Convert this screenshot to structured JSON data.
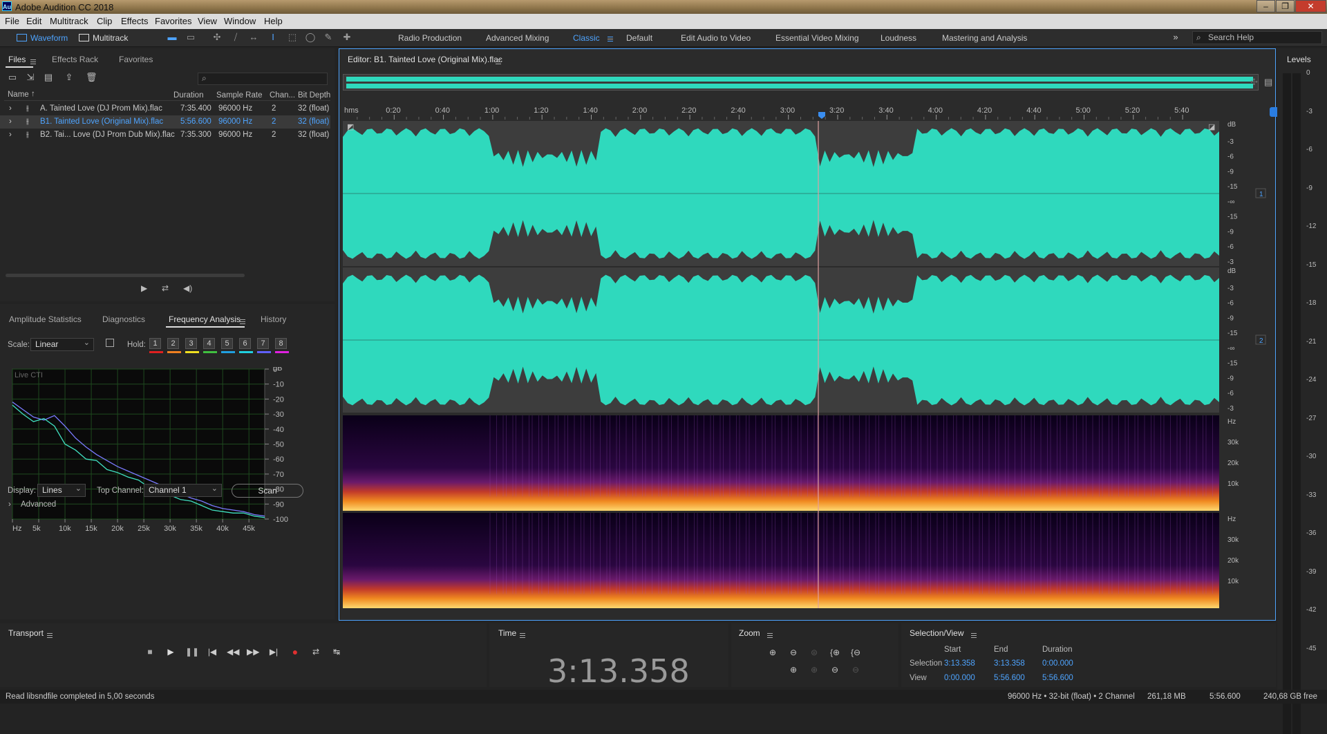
{
  "window": {
    "title": "Adobe Audition CC 2018",
    "app_icon": "Au"
  },
  "menu": [
    "File",
    "Edit",
    "Multitrack",
    "Clip",
    "Effects",
    "Favorites",
    "View",
    "Window",
    "Help"
  ],
  "modes": {
    "waveform": "Waveform",
    "multitrack": "Multitrack"
  },
  "workspaces": [
    "Radio Production",
    "Advanced Mixing",
    "Classic",
    "Default",
    "Edit Audio to Video",
    "Essential Video Mixing",
    "Loudness",
    "Mastering and Analysis"
  ],
  "active_workspace": "Classic",
  "search_help": {
    "placeholder": "Search Help"
  },
  "files_panel": {
    "tabs": [
      "Files",
      "Effects Rack",
      "Favorites"
    ],
    "columns": [
      "Name",
      "Duration",
      "Sample Rate",
      "Chan...",
      "Bit Depth"
    ],
    "rows": [
      {
        "name": "A. Tainted Love (DJ Prom Mix).flac",
        "duration": "7:35.400",
        "rate": "96000 Hz",
        "chan": "2",
        "depth": "32 (float)",
        "selected": false
      },
      {
        "name": "B1. Tainted Love (Original Mix).flac",
        "duration": "5:56.600",
        "rate": "96000 Hz",
        "chan": "2",
        "depth": "32 (float)",
        "selected": true
      },
      {
        "name": "B2. Tai... Love (DJ Prom Dub Mix).flac",
        "duration": "7:35.300",
        "rate": "96000 Hz",
        "chan": "2",
        "depth": "32 (float)",
        "selected": false
      }
    ]
  },
  "analysis_panel": {
    "tabs": [
      "Amplitude Statistics",
      "Diagnostics",
      "Frequency Analysis",
      "History"
    ],
    "active_tab": "Frequency Analysis",
    "scale_label": "Scale:",
    "scale_value": "Linear",
    "hold_label": "Hold:",
    "hold_buttons": [
      "1",
      "2",
      "3",
      "4",
      "5",
      "6",
      "7",
      "8"
    ],
    "hold_colors": [
      "#e02020",
      "#f08020",
      "#f0e020",
      "#40c040",
      "#20a0e0",
      "#20d0e0",
      "#6060ff",
      "#e020e0"
    ],
    "live_label": "Live CTI",
    "display_label": "Display:",
    "display_value": "Lines",
    "topchannel_label": "Top Channel:",
    "topchannel_value": "Channel 1",
    "scan_label": "Scan",
    "advanced_label": "Advanced"
  },
  "chart_data": {
    "type": "line",
    "x_ticks": [
      "Hz",
      "5k",
      "10k",
      "15k",
      "20k",
      "25k",
      "30k",
      "35k",
      "40k",
      "45k"
    ],
    "y_ticks": [
      "dB",
      "0",
      "-10",
      "-20",
      "-30",
      "-40",
      "-50",
      "-60",
      "-70",
      "-80",
      "-90",
      "-100"
    ],
    "xlim": [
      0,
      48000
    ],
    "ylim": [
      -100,
      0
    ],
    "series": [
      {
        "color": "#7a7aff",
        "x": [
          0,
          2000,
          4000,
          6000,
          8000,
          10000,
          12000,
          14000,
          16000,
          18000,
          20000,
          22000,
          24000,
          26000,
          28000,
          30000,
          32000,
          34000,
          36000,
          38000,
          40000,
          42000,
          44000,
          46000,
          48000
        ],
        "y": [
          -22,
          -27,
          -32,
          -34,
          -31,
          -38,
          -46,
          -52,
          -57,
          -61,
          -65,
          -68,
          -71,
          -74,
          -77,
          -80,
          -83,
          -86,
          -88,
          -91,
          -93,
          -94,
          -95,
          -97,
          -98
        ]
      },
      {
        "color": "#40e0c0",
        "x": [
          0,
          2000,
          4000,
          6000,
          8000,
          10000,
          12000,
          14000,
          16000,
          18000,
          20000,
          22000,
          24000,
          26000,
          28000,
          30000,
          32000,
          34000,
          36000,
          38000,
          40000,
          42000,
          44000,
          46000,
          48000
        ],
        "y": [
          -24,
          -30,
          -35,
          -33,
          -38,
          -50,
          -54,
          -60,
          -61,
          -67,
          -69,
          -72,
          -74,
          -79,
          -81,
          -84,
          -87,
          -88,
          -91,
          -94,
          -95,
          -96,
          -96,
          -98,
          -99
        ]
      }
    ]
  },
  "editor": {
    "title": "Editor: B1. Tainted Love (Original Mix).flac",
    "ruler_unit": "hms",
    "ruler": [
      "0:20",
      "0:40",
      "1:00",
      "1:20",
      "1:40",
      "2:00",
      "2:20",
      "2:40",
      "3:00",
      "3:20",
      "3:40",
      "4:00",
      "4:20",
      "4:40",
      "5:00",
      "5:20",
      "5:40"
    ],
    "db_ticks": [
      "dB",
      "-3",
      "-6",
      "-9",
      "-15",
      "-∞",
      "-15",
      "-9",
      "-6",
      "-3"
    ],
    "channels": [
      "1",
      "2"
    ],
    "spec_ticks": [
      "Hz",
      "30k",
      "20k",
      "10k"
    ]
  },
  "levels": {
    "title": "Levels",
    "ticks": [
      "0",
      "-3",
      "-6",
      "-9",
      "-12",
      "-15",
      "-18",
      "-21",
      "-24",
      "-27",
      "-30",
      "-33",
      "-36",
      "-39",
      "-42",
      "-45"
    ]
  },
  "transport": {
    "title": "Transport"
  },
  "time": {
    "title": "Time",
    "value": "3:13.358"
  },
  "zoom": {
    "title": "Zoom"
  },
  "selection": {
    "title": "Selection/View",
    "headers": [
      "Start",
      "End",
      "Duration"
    ],
    "rows": [
      {
        "label": "Selection",
        "start": "3:13.358",
        "end": "3:13.358",
        "duration": "0:00.000"
      },
      {
        "label": "View",
        "start": "0:00.000",
        "end": "5:56.600",
        "duration": "5:56.600"
      }
    ]
  },
  "status": {
    "left": "Read libsndfile completed in 5,00 seconds",
    "format": "96000 Hz • 32-bit (float) • 2 Channel",
    "size": "261,18 MB",
    "duration": "5:56.600",
    "free": "240,68 GB free"
  }
}
